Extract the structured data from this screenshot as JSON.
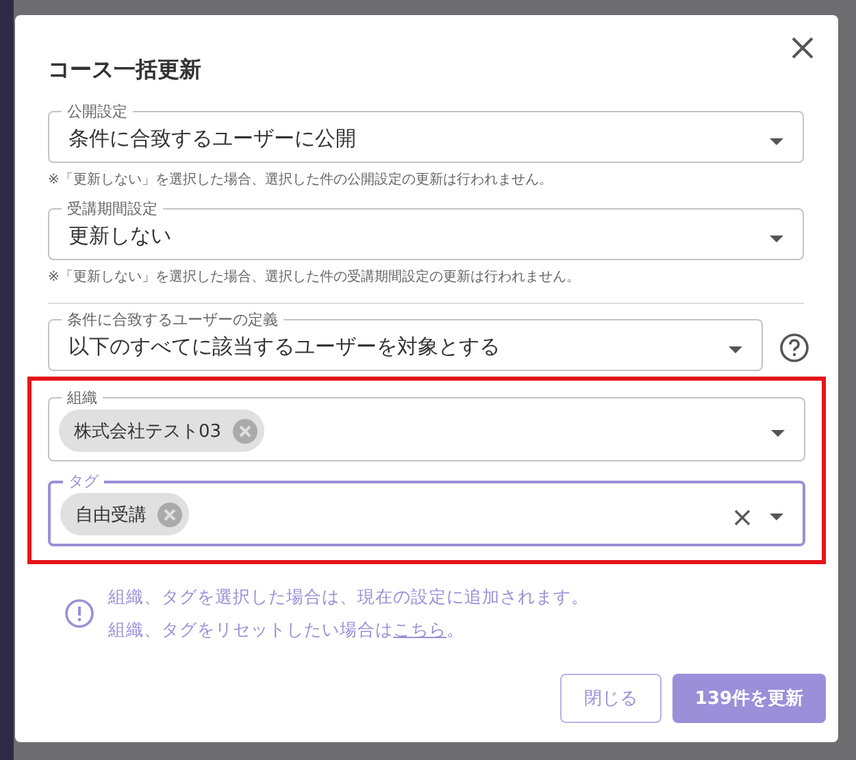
{
  "dialog": {
    "title": "コース一括更新",
    "selects": [
      {
        "label": "公開設定",
        "value": "条件に合致するユーザーに公開",
        "note": "※「更新しない」を選択した場合、選択した件の公開設定の更新は行われません。"
      },
      {
        "label": "受講期間設定",
        "value": "更新しない",
        "note": "※「更新しない」を選択した場合、選択した件の受講期間設定の更新は行われません。"
      }
    ],
    "condition": {
      "label": "条件に合致するユーザーの定義",
      "value": "以下のすべてに該当するユーザーを対象とする"
    },
    "filters": [
      {
        "label": "組織",
        "chips": [
          "株式会社テスト03"
        ],
        "focused": false
      },
      {
        "label": "タグ",
        "chips": [
          "自由受講"
        ],
        "focused": true
      }
    ],
    "info": {
      "line_1": "組織、タグを選択した場合は、現在の設定に追加されます。",
      "line_2": "組織、タグをリセットしたい場合は",
      "link": "こちら",
      "line_2_end": "。"
    },
    "buttons": [
      {
        "label": "閉じる",
        "kind": "secondary"
      },
      {
        "label": "139件を更新",
        "kind": "primary"
      }
    ]
  }
}
